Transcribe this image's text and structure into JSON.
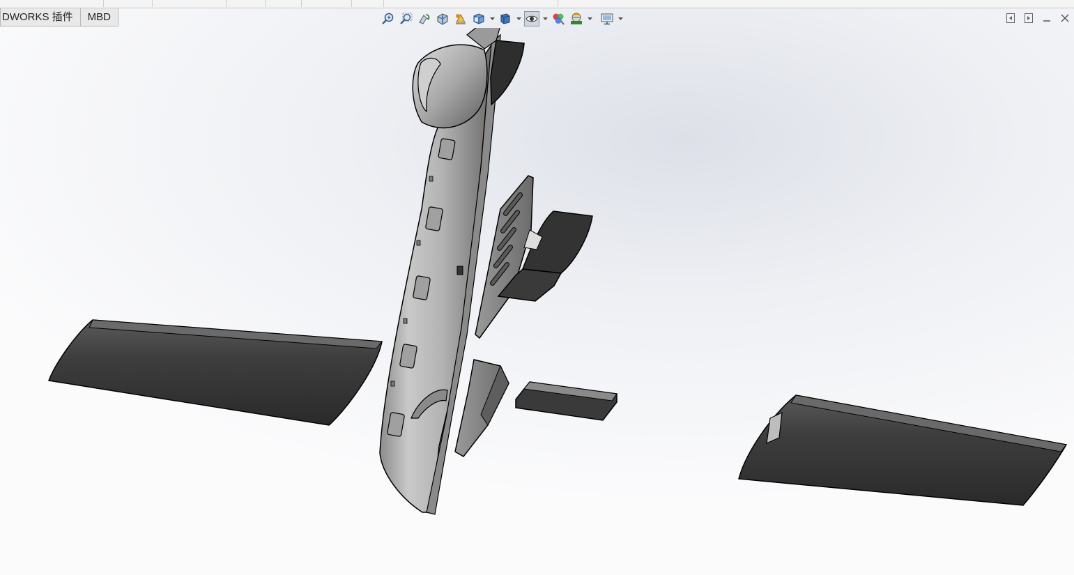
{
  "command_manager": {
    "tabs": [
      {
        "label": "DWORKS 插件"
      },
      {
        "label": "MBD"
      }
    ]
  },
  "heads_up_toolbar": {
    "buttons": [
      {
        "icon": "zoom-to-fit-icon"
      },
      {
        "icon": "zoom-to-area-icon"
      },
      {
        "icon": "previous-view-icon"
      },
      {
        "icon": "section-view-icon"
      },
      {
        "icon": "dynamic-annotation-icon"
      },
      {
        "icon": "view-orientation-icon",
        "has_menu": true
      },
      {
        "icon": "display-style-icon",
        "has_menu": true
      },
      {
        "icon": "hide-show-items-icon",
        "has_menu": true,
        "active": true
      },
      {
        "icon": "edit-appearance-icon"
      },
      {
        "icon": "apply-scene-icon",
        "has_menu": true
      },
      {
        "icon": "view-settings-icon",
        "has_menu": true
      }
    ]
  },
  "window_controls": [
    "restore-left-icon",
    "restore-right-icon",
    "minimize-icon",
    "close-icon"
  ],
  "model": {
    "parts": [
      "fuselage",
      "nose-cone",
      "tail-fin",
      "horizontal-stabilizer",
      "rudder",
      "battery-cover",
      "left-wing",
      "right-wing"
    ],
    "colors": {
      "fuselage": "#b8b8b8",
      "dark_part": "#3a3a3a",
      "edge": "#000000"
    }
  }
}
